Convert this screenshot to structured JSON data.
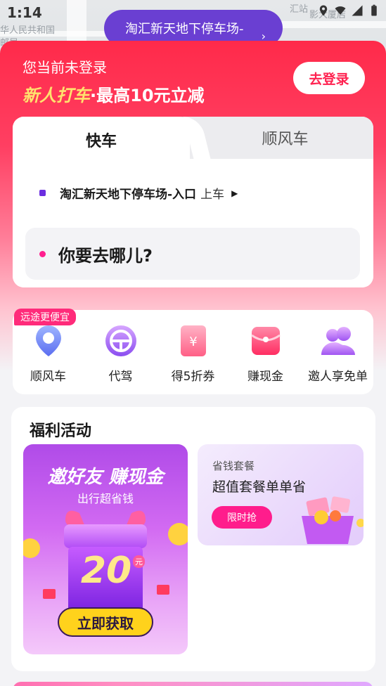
{
  "status_bar": {
    "time": "1:14"
  },
  "map": {
    "labels": [
      "华人民共和国",
      "邮局",
      "汇站",
      "影大厦店"
    ],
    "pickup_bubble": "淘汇新天地下停车场-"
  },
  "header": {
    "login_status": "您当前未登录",
    "promo_highlight": "新人打车",
    "promo_rest": "·最高10元立减",
    "login_button": "去登录"
  },
  "ride": {
    "tabs": [
      {
        "label": "快车",
        "active": true
      },
      {
        "label": "顺风车",
        "active": false
      }
    ],
    "pickup_place": "淘汇新天地下停车场-入口",
    "pickup_suffix": "上车",
    "destination_placeholder": "你要去哪儿?"
  },
  "services": {
    "badge": "远途更便宜",
    "items": [
      {
        "label": "顺风车",
        "icon": "carpool-pin-icon"
      },
      {
        "label": "代驾",
        "icon": "steering-wheel-icon"
      },
      {
        "label": "得5折券",
        "icon": "coupon-icon"
      },
      {
        "label": "赚现金",
        "icon": "red-envelope-icon"
      },
      {
        "label": "邀人享免单",
        "icon": "invite-friends-icon"
      }
    ]
  },
  "activities": {
    "title": "福利活动",
    "invite": {
      "title": "邀好友 赚现金",
      "subtitle": "出行超省钱",
      "amount": "20",
      "unit": "元",
      "button": "立即获取"
    },
    "saving": {
      "tag": "省钱套餐",
      "title": "超值套餐单单省",
      "button": "限时抢"
    }
  },
  "colors": {
    "brand_red": "#ff2a4a",
    "accent_pink": "#ff1d8c",
    "purple": "#6b2ee0",
    "promo_yellow": "#ffe26d"
  }
}
